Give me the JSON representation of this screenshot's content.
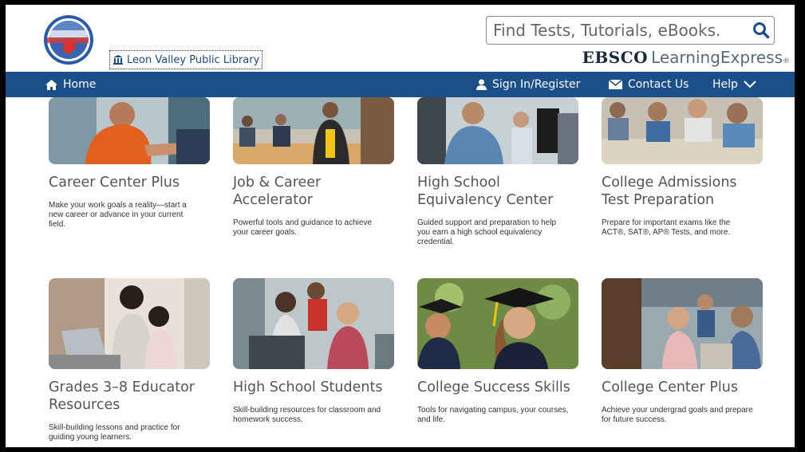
{
  "header": {
    "library_name": "Leon Valley Public Library",
    "logo_text": "Learning Express",
    "search_placeholder": "Find Tests, Tutorials, eBooks.",
    "brand_primary": "EBSCO",
    "brand_secondary": "LearningExpress",
    "brand_mark": "®"
  },
  "nav": {
    "home": "Home",
    "signin": "Sign In/Register",
    "contact": "Contact Us",
    "help": "Help"
  },
  "colors": {
    "nav_bg": "#1b4f8a",
    "title_text": "#555555",
    "link_text": "#1a4a7a"
  },
  "cards": [
    {
      "title": "Career Center Plus",
      "desc": "Make your work goals a reality—start a new career or advance in your current field.",
      "image": "woman-handshake-photo"
    },
    {
      "title": "Job & Career Accelerator",
      "desc": "Powerful tools and guidance to achieve your career goals.",
      "image": "office-meeting-photo"
    },
    {
      "title": "High School Equivalency Center",
      "desc": "Guided support and preparation to help you earn a high school equivalency credential.",
      "image": "students-computers-photo"
    },
    {
      "title": "College Admissions Test Preparation",
      "desc": "Prepare for important exams like the ACT®, SAT®, AP® Tests, and more.",
      "image": "students-exam-photo"
    },
    {
      "title": "Grades 3–8 Educator Resources",
      "desc": "Skill-building lessons and practice for guiding young learners.",
      "image": "parent-child-laptop-photo"
    },
    {
      "title": "High School Students",
      "desc": "Skill-building resources for classroom and homework success.",
      "image": "teens-laptop-photo"
    },
    {
      "title": "College Success Skills",
      "desc": "Tools for navigating campus, your courses, and life.",
      "image": "graduates-photo"
    },
    {
      "title": "College Center Plus",
      "desc": "Achieve your undergrad goals and prepare for future success.",
      "image": "lecture-hall-photo"
    }
  ]
}
